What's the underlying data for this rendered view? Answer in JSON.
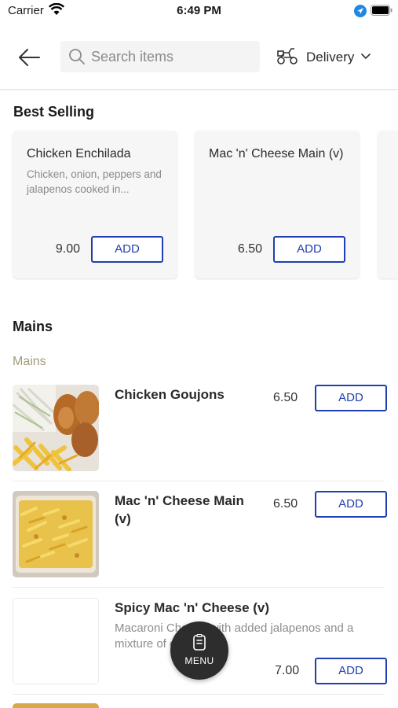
{
  "status_bar": {
    "carrier": "Carrier",
    "time": "6:49 PM"
  },
  "header": {
    "search_placeholder": "Search items",
    "delivery_label": "Delivery"
  },
  "best_selling": {
    "title": "Best Selling",
    "cards": [
      {
        "name": "Chicken Enchilada",
        "description": "Chicken, onion, peppers and jalapenos cooked in...",
        "price": "9.00",
        "add_label": "ADD"
      },
      {
        "name": "Mac 'n' Cheese Main (v)",
        "description": "",
        "price": "6.50",
        "add_label": "ADD"
      }
    ]
  },
  "mains": {
    "title": "Mains",
    "subtitle": "Mains",
    "items": [
      {
        "name": "Chicken Goujons",
        "description": "",
        "price": "6.50",
        "add_label": "ADD"
      },
      {
        "name": "Mac 'n' Cheese Main (v)",
        "description": "",
        "price": "6.50",
        "add_label": "ADD"
      },
      {
        "name": "Spicy Mac 'n' Cheese (v)",
        "description": "Macaroni Cheese with added jalapenos and a mixture of cheeses",
        "price": "7.00",
        "add_label": "ADD"
      }
    ]
  },
  "fab": {
    "label": "MENU"
  },
  "colors": {
    "accent": "#1f3fb0",
    "subsection": "#a39a78",
    "fab": "#2d2d2d"
  }
}
